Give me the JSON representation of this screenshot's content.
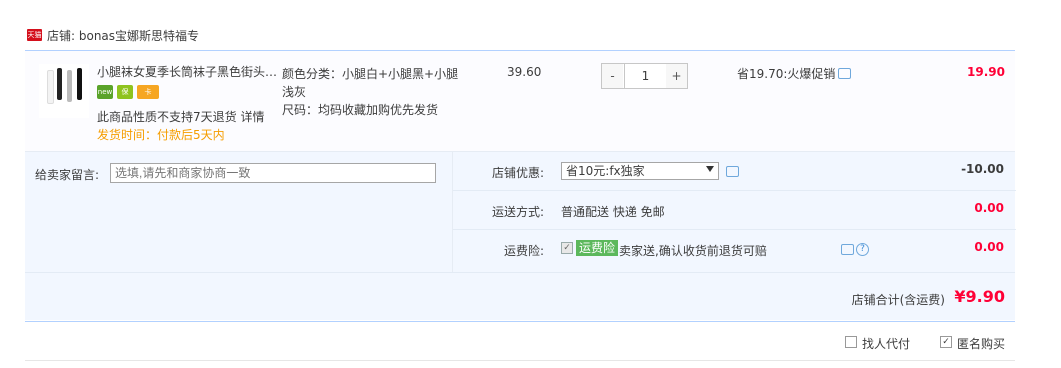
{
  "shop": {
    "name": "店铺: bonas宝娜斯思特福专",
    "badge": "天猫"
  },
  "item": {
    "title": "小腿袜女夏季长筒袜子黑色街头…",
    "badges": [
      "new",
      "保",
      "卡"
    ],
    "policy": "此商品性质不支持7天退货 详情",
    "ship_time": "发货时间：付款后5天内",
    "color_sku": "颜色分类：小腿白+小腿黑+小腿浅灰",
    "size_sku": "尺码：均码收藏加购优先发货",
    "unit_price": "39.60",
    "qty_minus": "-",
    "qty_plus": "+",
    "quantity": "1",
    "promo": "省19.70:火爆促销",
    "total": "19.90"
  },
  "message": {
    "label": "给卖家留言:",
    "placeholder": "选填,请先和商家协商一致"
  },
  "coupon": {
    "label": "店铺优惠:",
    "selected": "省10元:fx独家",
    "amount": "-10.00"
  },
  "shipping": {
    "label": "运送方式:",
    "value": "普通配送 快递 免邮",
    "amount": "0.00"
  },
  "insurance": {
    "label": "运费险:",
    "checked": "✓",
    "tag": "运费险",
    "text": "卖家送,确认收货前退货可赔",
    "amount": "0.00",
    "help": "?"
  },
  "summary": {
    "label": "店铺合计(含运费)",
    "amount": "¥9.90"
  },
  "options": {
    "proxy_pay": {
      "label": "找人代付",
      "checked": ""
    },
    "anonymous": {
      "label": "匿名购买",
      "checked": "✓"
    }
  },
  "colors": {
    "accent": "#ff0036",
    "border": "#b2d1ff",
    "panel": "#f2f7ff"
  }
}
